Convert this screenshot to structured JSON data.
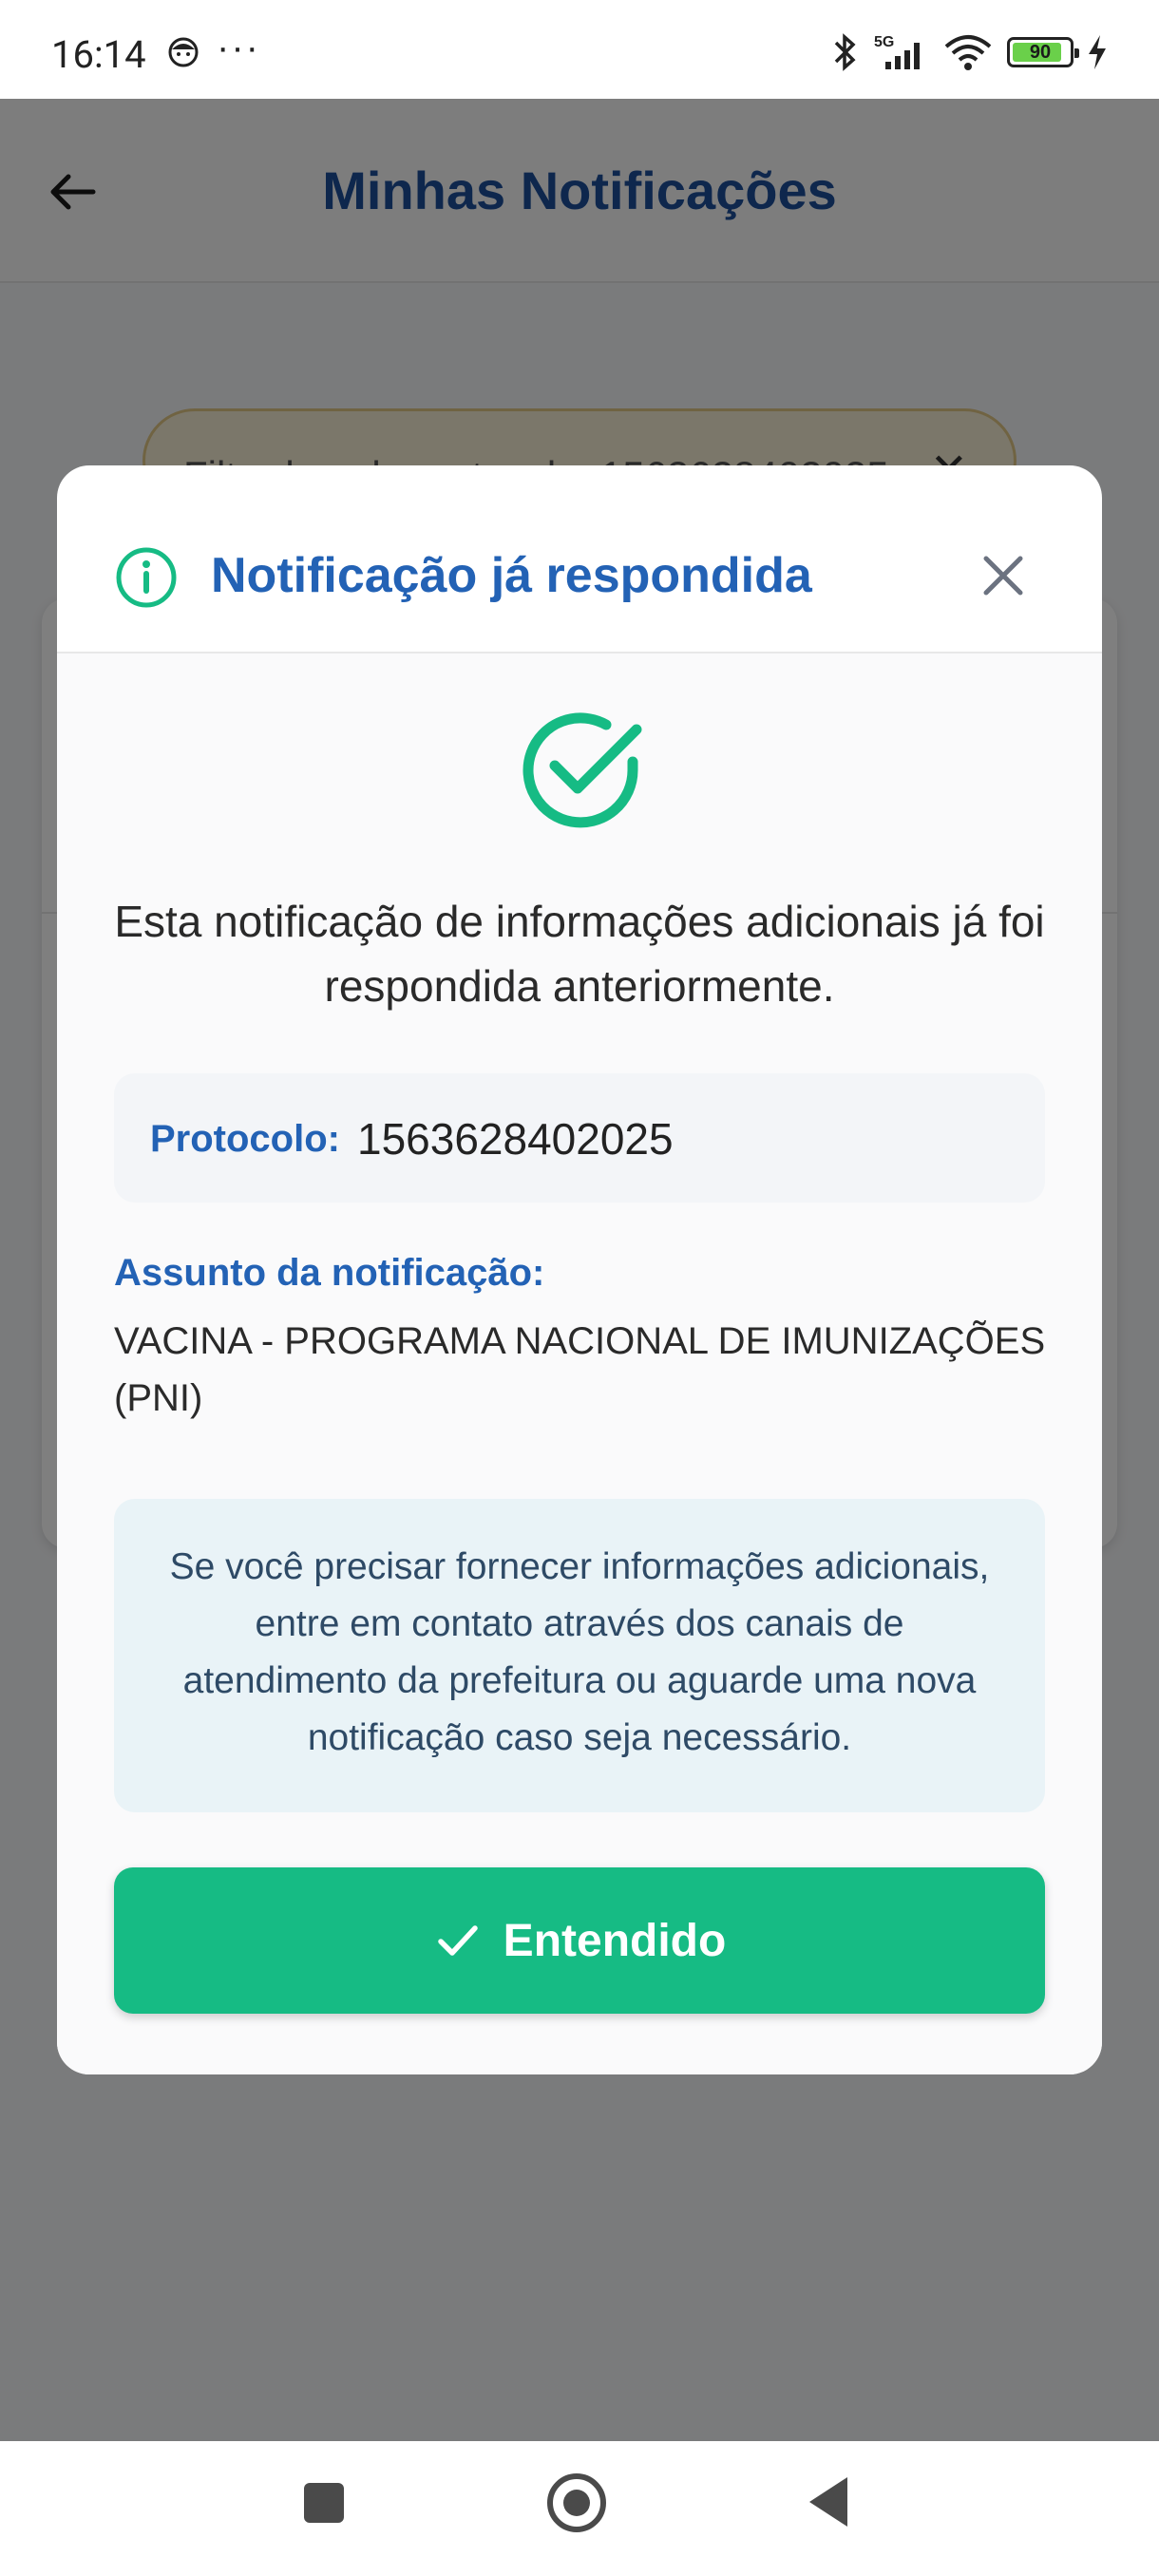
{
  "status_bar": {
    "time": "16:14",
    "dots": "···",
    "network": "5G",
    "battery": "90"
  },
  "app_bar": {
    "title": "Minhas Notificações"
  },
  "filter": {
    "label": "Filtrado pelo protocolo: 1563628402025"
  },
  "dialog": {
    "title": "Notificação já respondida",
    "message": "Esta notificação de informações adicionais já foi respondida anteriormente.",
    "protocol_label": "Protocolo:",
    "protocol_value": "1563628402025",
    "subject_label": "Assunto da notificação:",
    "subject_value": "VACINA - PROGRAMA NACIONAL DE IMUNIZAÇÕES (PNI)",
    "note": "Se você precisar fornecer informações adicionais, entre em contato através dos canais de atendimento da prefeitura ou aguarde uma nova notificação caso seja necessário.",
    "button_label": "Entendido"
  },
  "colors": {
    "primary_blue": "#2362b5",
    "success_green": "#16bb84",
    "note_bg": "#e9f3f7"
  }
}
